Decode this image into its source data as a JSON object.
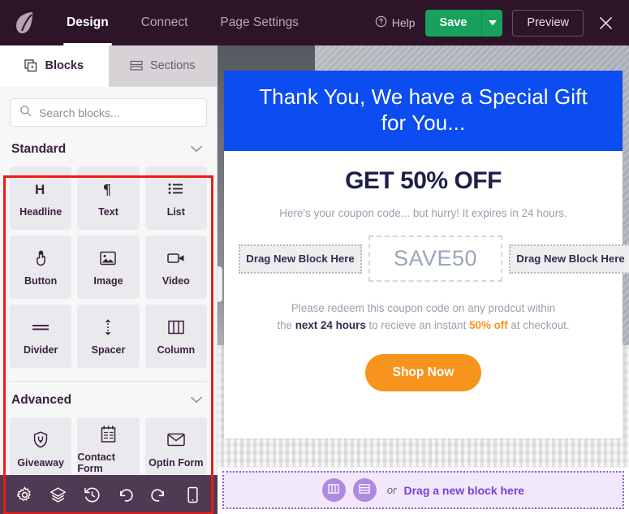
{
  "topbar": {
    "logo_icon": "leaf-logo-icon",
    "nav": [
      {
        "label": "Design",
        "active": true
      },
      {
        "label": "Connect",
        "active": false
      },
      {
        "label": "Page Settings",
        "active": false
      }
    ],
    "help_label": "Help",
    "help_icon": "question-circle-icon",
    "save_label": "Save",
    "save_caret_icon": "chevron-down-icon",
    "preview_label": "Preview",
    "close_icon": "close-icon",
    "colors": {
      "bar_background": "#2e1428",
      "save_green": "#18a05f"
    }
  },
  "left_panel": {
    "tabs": [
      {
        "label": "Blocks",
        "icon": "blocks-icon",
        "active": true
      },
      {
        "label": "Sections",
        "icon": "sections-icon",
        "active": false
      }
    ],
    "search": {
      "placeholder": "Search blocks...",
      "value": "",
      "icon": "search-icon"
    },
    "groups": [
      {
        "title": "Standard",
        "collapse_icon": "chevron-down-icon",
        "items": [
          {
            "label": "Headline",
            "icon": "headline-h-icon"
          },
          {
            "label": "Text",
            "icon": "paragraph-pilcrow-icon"
          },
          {
            "label": "List",
            "icon": "list-bullet-icon"
          },
          {
            "label": "Button",
            "icon": "click-hand-icon"
          },
          {
            "label": "Image",
            "icon": "image-icon"
          },
          {
            "label": "Video",
            "icon": "video-camera-icon"
          },
          {
            "label": "Divider",
            "icon": "divider-lines-icon"
          },
          {
            "label": "Spacer",
            "icon": "spacer-arrows-icon"
          },
          {
            "label": "Column",
            "icon": "columns-icon"
          }
        ]
      },
      {
        "title": "Advanced",
        "collapse_icon": "chevron-down-icon",
        "items": [
          {
            "label": "Giveaway",
            "icon": "giveaway-trophy-icon"
          },
          {
            "label": "Contact Form",
            "icon": "contact-form-icon"
          },
          {
            "label": "Optin Form",
            "icon": "envelope-icon"
          }
        ]
      }
    ],
    "highlight_box_color": "#ee1b16"
  },
  "bottom_toolbar": {
    "items": [
      {
        "icon": "gear-icon"
      },
      {
        "icon": "layers-icon"
      },
      {
        "icon": "history-clock-icon"
      },
      {
        "icon": "undo-icon"
      },
      {
        "icon": "redo-icon"
      },
      {
        "icon": "mobile-device-icon"
      }
    ],
    "background": "#4e3a52"
  },
  "canvas": {
    "collapse_handle_icon": "chevron-left-icon",
    "card": {
      "header_title": "Thank You, We have a Special Gift for You...",
      "header_background": "#0b4df0",
      "offer_title": "GET 50% OFF",
      "subtext": "Here's your coupon code... but hurry! It expires in 24 hours.",
      "dropzone_left_label": "Drag New Block Here",
      "coupon_code": "SAVE50",
      "dropzone_right_label": "Drag New Block Here",
      "redeem_line1": "Please redeem this coupon code on any prodcut within",
      "redeem_line2_pre": "the ",
      "redeem_line2_bold": "next 24 hours",
      "redeem_line2_mid": " to recieve an instant ",
      "redeem_line2_orange": "50% off",
      "redeem_line2_post": " at checkout.",
      "cta_label": "Shop Now",
      "cta_color": "#f7941d"
    },
    "footer_dropzone": {
      "column_icon": "columns-icon",
      "section_icon": "section-rows-icon",
      "or_label": "or",
      "label": "Drag a new block here",
      "accent_color": "#7b3fd4"
    }
  }
}
